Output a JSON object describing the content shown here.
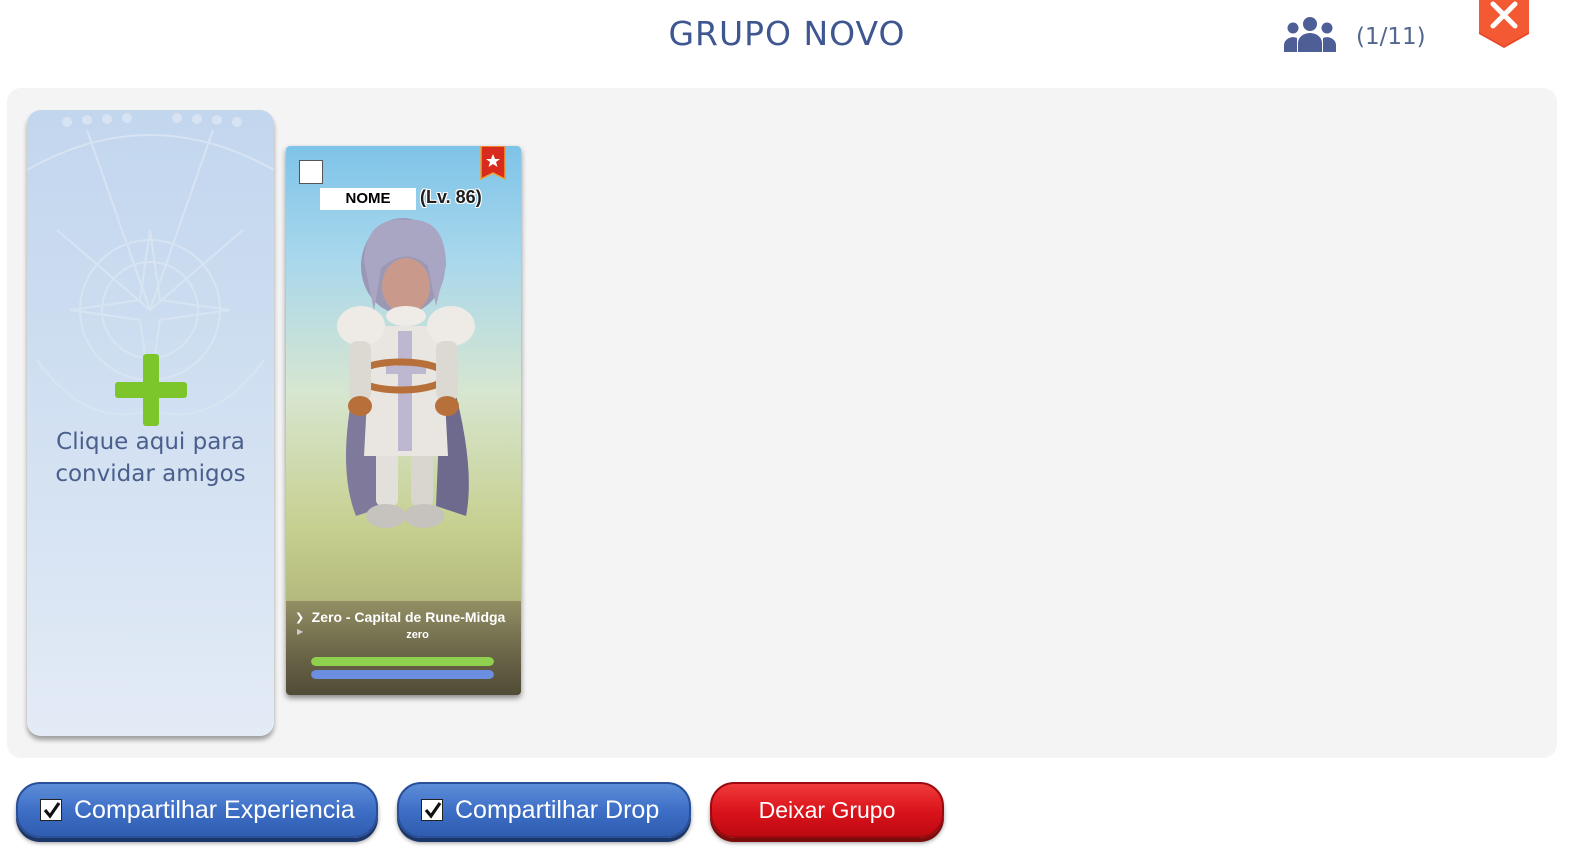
{
  "header": {
    "title": "GRUPO NOVO",
    "member_count": "(1/11)",
    "members_icon": "group-icon",
    "close_icon": "close-icon"
  },
  "invite": {
    "text": "Clique aqui para\nconvidar amigos",
    "icon": "plus-icon"
  },
  "members": [
    {
      "name": "NOME",
      "level": "(Lv. 86)",
      "map": "Zero - Capital de Rune-Midga",
      "server": "zero",
      "is_leader": true,
      "hp_fraction": 1.0,
      "sp_fraction": 1.0
    }
  ],
  "footer": {
    "share_exp_label": "Compartilhar Experiencia",
    "share_exp_checked": true,
    "share_drop_label": "Compartilhar Drop",
    "share_drop_checked": true,
    "leave_label": "Deixar Grupo"
  },
  "colors": {
    "title": "#3f5790",
    "hp_bar": "#8fd14f",
    "sp_bar": "#6c8ee0",
    "leave_button": "#d9121a",
    "share_button": "#3e6fc6"
  }
}
